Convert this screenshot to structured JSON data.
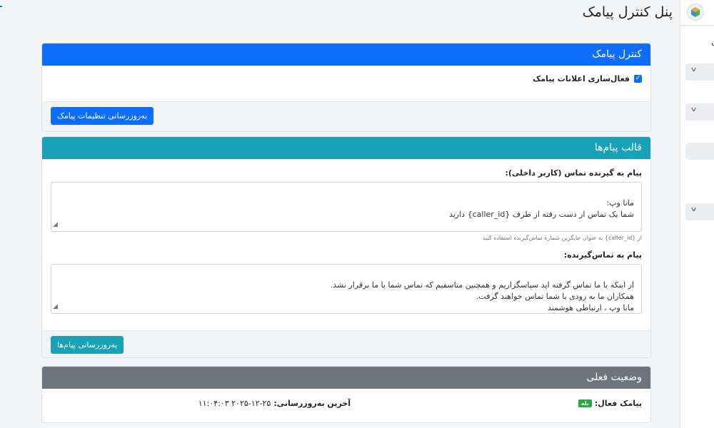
{
  "page": {
    "title": "پنل کنترل پیامک"
  },
  "sidebar": {
    "partial_text": "ل"
  },
  "sms_control": {
    "header": "کنترل پیامک",
    "enable_label": "فعال‌سازی اعلانات پیامک",
    "enable_checked": true,
    "update_button": "به‌روزرسانی تنظیمات پیامک"
  },
  "templates": {
    "header": "قالب پیام‌ها",
    "internal_label": "پیام به گیرنده تماس (کاربر داخلی):",
    "internal_value": "مانا وپ:\nشما یک تماس از دست رفته از طرف {caller_id} دارید",
    "internal_help": "از {caller_id} به عنوان جایگزین شماره تماس‌گیرنده استفاده کنید",
    "caller_label": "پیام به تماس‌گیرنده:",
    "caller_value": "از اینکه با ما تماس گرفته اید سپاسگزاریم و همچنین متاسفیم که تماس شما با ما برقرار نشد.\nهمکاران ما به زودی با شما تماس خواهند گرفت.\nمانا وپ ، ارتباطی هوشمند",
    "update_button": "به‌روزرسانی پیام‌ها"
  },
  "status": {
    "header": "وضعیت فعلی",
    "active_label": "پیامک فعال:",
    "active_badge": "بله",
    "last_update_label": "آخرین به‌روزرسانی:",
    "last_update_value": "۲۰۲۵-۱۲-۲۵ ۱۱:۰۴:۰۳"
  }
}
